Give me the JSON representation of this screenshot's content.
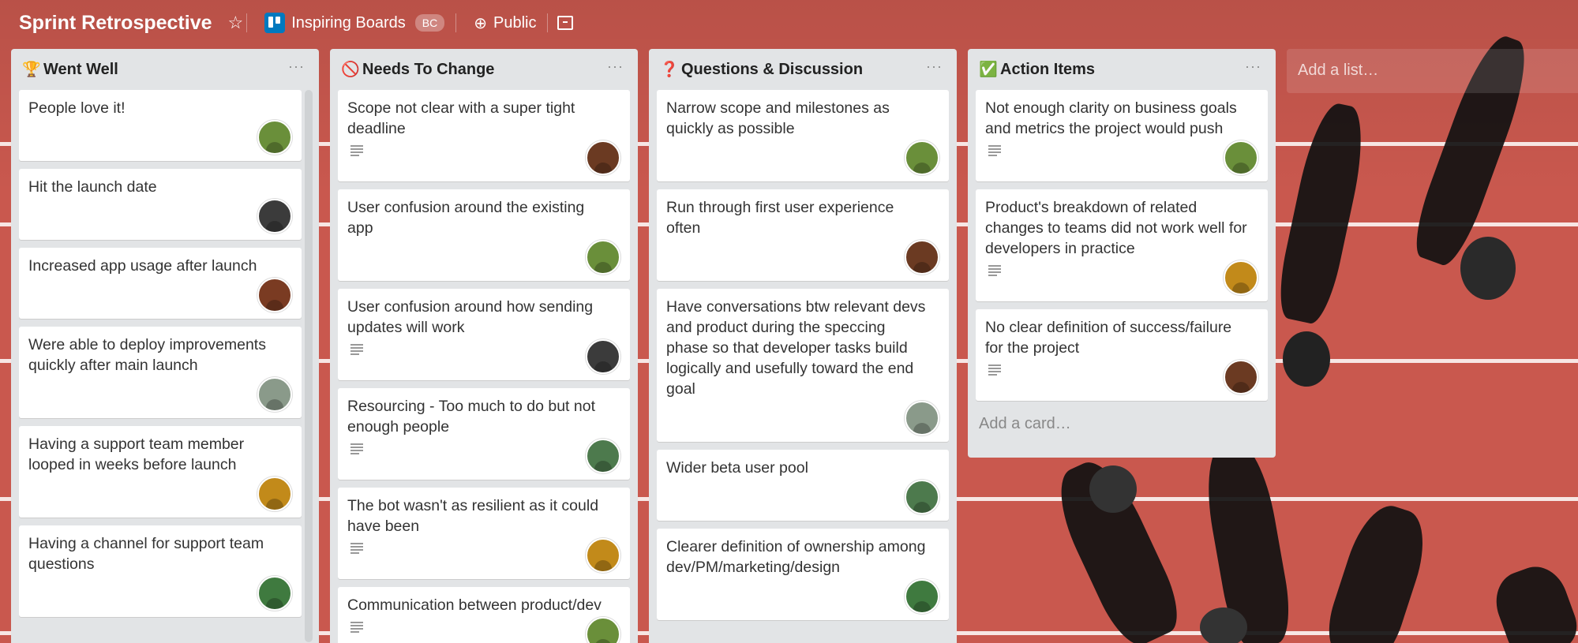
{
  "header": {
    "board_title": "Sprint Retrospective",
    "team_name": "Inspiring Boards",
    "team_badge": "BC",
    "visibility": "Public",
    "icons": [
      "star-icon",
      "board-icon",
      "globe-icon",
      "archive-icon"
    ]
  },
  "colors": {
    "background": "#c9584e",
    "list_bg": "#e2e4e6",
    "card_bg": "#ffffff",
    "brand_blue": "#0079bf"
  },
  "lists": [
    {
      "emoji": "🏆",
      "title": "Went Well",
      "menu": "···",
      "cards": [
        {
          "text": "People love it!",
          "desc": false,
          "avatar": "#6a8f3a"
        },
        {
          "text": "Hit the launch date",
          "desc": false,
          "avatar": "#3b3b3b"
        },
        {
          "text": "Increased app usage after launch",
          "desc": false,
          "avatar": "#7a3b22"
        },
        {
          "text": "Were able to deploy improvements quickly after main launch",
          "desc": false,
          "avatar": "#8a9a8a"
        },
        {
          "text": "Having a support team member looped in weeks before launch",
          "desc": false,
          "avatar": "#c28a1a"
        },
        {
          "text": "Having a channel for support team questions",
          "desc": false,
          "avatar": "#3f7a3f"
        }
      ]
    },
    {
      "emoji": "🚫",
      "title": "Needs To Change",
      "menu": "···",
      "cards": [
        {
          "text": "Scope not clear with a super tight deadline",
          "desc": true,
          "avatar": "#6b3a22"
        },
        {
          "text": "User confusion around the existing app",
          "desc": false,
          "avatar": "#6a8f3a"
        },
        {
          "text": "User confusion around how sending updates will work",
          "desc": true,
          "avatar": "#3b3b3b"
        },
        {
          "text": "Resourcing - Too much to do but not enough people",
          "desc": true,
          "avatar": "#4d7a4d"
        },
        {
          "text": "The bot wasn't as resilient as it could have been",
          "desc": true,
          "avatar": "#c28a1a"
        },
        {
          "text": "Communication between product/dev",
          "desc": true,
          "avatar": "#6a8f3a"
        }
      ]
    },
    {
      "emoji": "❓",
      "title": "Questions & Discussion",
      "menu": "···",
      "cards": [
        {
          "text": "Narrow scope and milestones as quickly as possible",
          "desc": false,
          "avatar": "#6a8f3a"
        },
        {
          "text": "Run through first user experience often",
          "desc": false,
          "avatar": "#6b3a22"
        },
        {
          "text": "Have conversations btw relevant devs and product during the speccing phase so that developer tasks build logically and usefully toward the end goal",
          "desc": false,
          "avatar": "#8a9a8a"
        },
        {
          "text": "Wider beta user pool",
          "desc": false,
          "avatar": "#4d7a4d"
        },
        {
          "text": "Clearer definition of ownership among dev/PM/marketing/design",
          "desc": false,
          "avatar": "#3f7a3f"
        }
      ]
    },
    {
      "emoji": "✅",
      "title": "Action Items",
      "menu": "···",
      "add_card": "Add a card…",
      "cards": [
        {
          "text": "Not enough clarity on business goals and metrics the project would push",
          "desc": true,
          "avatar": "#6a8f3a"
        },
        {
          "text": "Product's breakdown of related changes to teams did not work well for developers in practice",
          "desc": true,
          "avatar": "#c28a1a"
        },
        {
          "text": "No clear definition of success/failure for the project",
          "desc": true,
          "avatar": "#6b3a22"
        }
      ]
    }
  ],
  "add_list": "Add a list…"
}
